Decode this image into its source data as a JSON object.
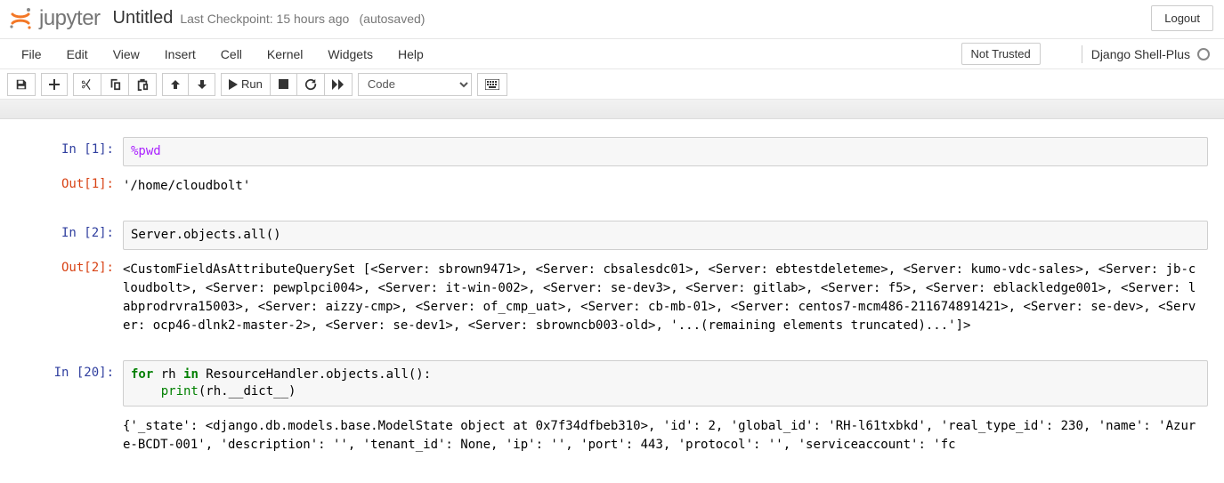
{
  "header": {
    "logo_text": "jupyter",
    "notebook_name": "Untitled",
    "checkpoint": "Last Checkpoint: 15 hours ago",
    "autosave": "(autosaved)",
    "logout": "Logout"
  },
  "menubar": {
    "items": [
      "File",
      "Edit",
      "View",
      "Insert",
      "Cell",
      "Kernel",
      "Widgets",
      "Help"
    ],
    "trust": "Not Trusted",
    "kernel_name": "Django Shell-Plus"
  },
  "toolbar": {
    "run_label": "Run",
    "cell_type": "Code"
  },
  "cells": [
    {
      "in_prompt": "In [1]:",
      "code_html": "<span class='cm-magic'>%pwd</span>",
      "out_prompt": "Out[1]:",
      "output": "'/home/cloudbolt'"
    },
    {
      "in_prompt": "In [2]:",
      "code_html": "<span class='code-plain'>Server.objects.all()</span>",
      "out_prompt": "Out[2]:",
      "output": "<CustomFieldAsAttributeQuerySet [<Server: sbrown9471>, <Server: cbsalesdc01>, <Server: ebtestdeleteme>, <Server: kumo-vdc-sales>, <Server: jb-cloudbolt>, <Server: pewplpci004>, <Server: it-win-002>, <Server: se-dev3>, <Server: gitlab>, <Server: f5>, <Server: eblackledge001>, <Server: labprodrvra15003>, <Server: aizzy-cmp>, <Server: of_cmp_uat>, <Server: cb-mb-01>, <Server: centos7-mcm486-211674891421>, <Server: se-dev>, <Server: ocp46-dlnk2-master-2>, <Server: se-dev1>, <Server: sbrowncb003-old>, '...(remaining elements truncated)...']>"
    },
    {
      "in_prompt": "In [20]:",
      "code_html": "<span class='cm-keyword'>for</span> rh <span class='cm-keyword'>in</span> ResourceHandler.objects.all():\n    <span class='cm-builtin'>print</span>(rh.__dict__)",
      "out_prompt": "",
      "output": "{'_state': <django.db.models.base.ModelState object at 0x7f34dfbeb310>, 'id': 2, 'global_id': 'RH-l61txbkd', 'real_type_id': 230, 'name': 'Azure-BCDT-001', 'description': '', 'tenant_id': None, 'ip': '', 'port': 443, 'protocol': '', 'serviceaccount': 'fc"
    }
  ]
}
